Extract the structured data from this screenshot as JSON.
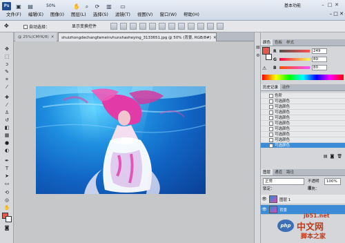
{
  "app": {
    "logo": "Ps",
    "zoom": "50%",
    "workspace": "基本功能",
    "window_controls": [
      "–",
      "□",
      "✕"
    ]
  },
  "menubar": {
    "items": [
      "文件(F)",
      "编辑(E)",
      "图像(I)",
      "图层(L)",
      "选择(S)",
      "滤镜(T)",
      "视图(V)",
      "窗口(W)",
      "帮助(H)"
    ],
    "right": "– □ ✕"
  },
  "options": {
    "auto_select": "自动选择：",
    "transform": "显示变换控件",
    "tool_icon": "✥"
  },
  "tabs": [
    {
      "label": "@ 25%(CMYK/8)",
      "close": "×"
    },
    {
      "label": "shuizhongdechangfameinvhunshasheying_3133651.jpg @ 50% (背景, RGB/8#)",
      "close": "×"
    }
  ],
  "panels": {
    "color": {
      "tabs": [
        "颜色",
        "色板",
        "样式"
      ],
      "r_label": "R",
      "r_value": "249",
      "g_label": "G",
      "g_value": "80",
      "b_label": "B",
      "b_value": "80",
      "fg_color": "#e15a4e",
      "warning_icon": "⚠"
    },
    "history": {
      "tabs": [
        "历史记录",
        "动作"
      ],
      "items": [
        "色阶",
        "可选颜色",
        "可选颜色",
        "可选颜色",
        "可选颜色",
        "可选颜色",
        "可选颜色",
        "可选颜色",
        "可选颜色",
        "可选颜色"
      ]
    },
    "layers": {
      "tabs": [
        "图层",
        "通道",
        "路径"
      ],
      "blend_mode": "正常",
      "opacity_label": "不透明度：",
      "opacity_value": "100%",
      "lock_label": "锁定：",
      "fill_label": "填充：",
      "layers": [
        {
          "name": "图层 1"
        },
        {
          "name": "背景"
        }
      ]
    }
  },
  "watermark": {
    "url": "jb51.net",
    "logo": "php",
    "title": "中文网",
    "subtitle": "脚本之家"
  }
}
